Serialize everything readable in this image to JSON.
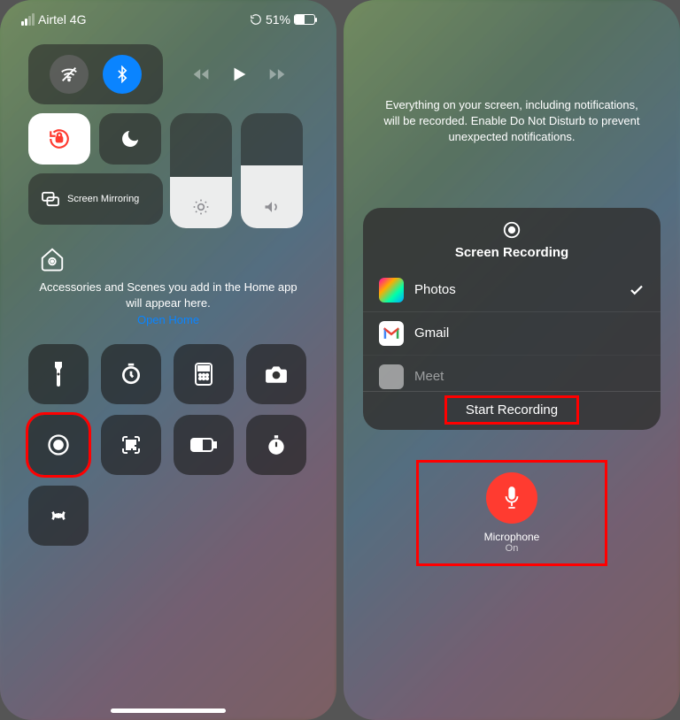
{
  "left": {
    "status": {
      "carrier": "Airtel 4G",
      "battery": "51%"
    },
    "screen_mirroring": "Screen Mirroring",
    "home": {
      "text": "Accessories and Scenes you add in the Home app will appear here.",
      "link": "Open Home"
    }
  },
  "right": {
    "info": "Everything on your screen, including notifications, will be recorded. Enable Do Not Disturb to prevent unexpected notifications.",
    "panel_title": "Screen Recording",
    "apps": {
      "photos": "Photos",
      "gmail": "Gmail",
      "meet": "Meet"
    },
    "start_button": "Start Recording",
    "mic": {
      "label": "Microphone",
      "status": "On"
    }
  }
}
